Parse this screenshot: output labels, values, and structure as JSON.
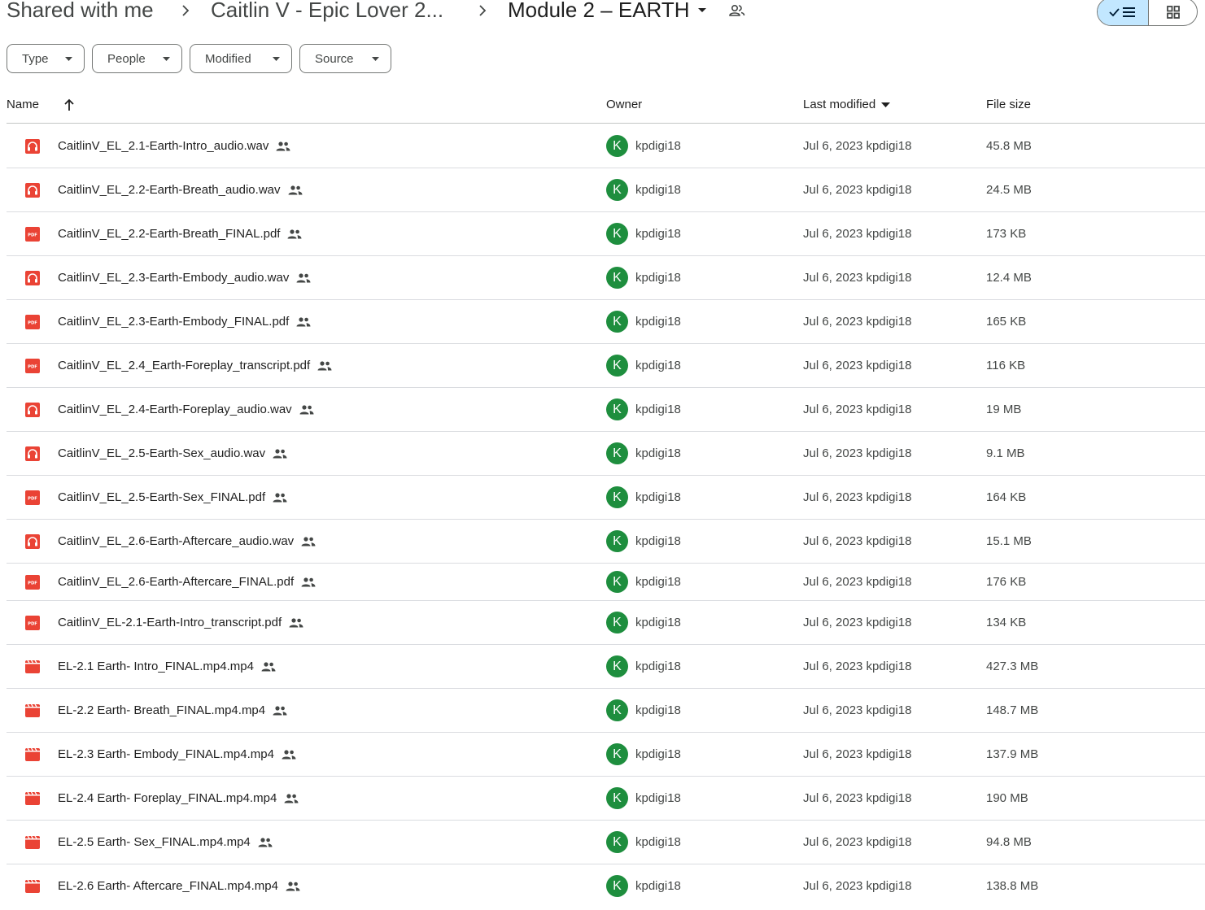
{
  "breadcrumb": {
    "root": "Shared with me",
    "parent": "Caitlin V - Epic Lover 2...",
    "current": "Module 2 – EARTH",
    "separator_icon": "chevron-right-icon",
    "current_menu_icon": "caret-down-icon",
    "shared_icon": "shared-folder-people-icon"
  },
  "view_toggle": {
    "list_icon": "check-list-view-icon",
    "grid_icon": "grid-view-icon",
    "selected": "list"
  },
  "filters": [
    {
      "label": "Type"
    },
    {
      "label": "People"
    },
    {
      "label": "Modified"
    },
    {
      "label": "Source"
    }
  ],
  "columns": {
    "name": "Name",
    "owner": "Owner",
    "last_modified": "Last modified",
    "file_size": "File size",
    "name_sort_icon": "arrow-up-icon",
    "modified_sort_icon": "caret-down-icon"
  },
  "colors": {
    "audio_pdf_red": "#ea4335",
    "owner_avatar_green": "#1e8e3e",
    "list_toggle_selected": "#c2e7ff"
  },
  "files": [
    {
      "name": "CaitlinV_EL_2.1-Earth-Intro_audio.wav",
      "type": "audio",
      "owner_initial": "K",
      "owner": "kpdigi18",
      "modified": "Jul 6, 2023 kpdigi18",
      "size": "45.8 MB"
    },
    {
      "name": "CaitlinV_EL_2.2-Earth-Breath_audio.wav",
      "type": "audio",
      "owner_initial": "K",
      "owner": "kpdigi18",
      "modified": "Jul 6, 2023 kpdigi18",
      "size": "24.5 MB"
    },
    {
      "name": "CaitlinV_EL_2.2-Earth-Breath_FINAL.pdf",
      "type": "pdf",
      "owner_initial": "K",
      "owner": "kpdigi18",
      "modified": "Jul 6, 2023 kpdigi18",
      "size": "173 KB"
    },
    {
      "name": "CaitlinV_EL_2.3-Earth-Embody_audio.wav",
      "type": "audio",
      "owner_initial": "K",
      "owner": "kpdigi18",
      "modified": "Jul 6, 2023 kpdigi18",
      "size": "12.4 MB"
    },
    {
      "name": "CaitlinV_EL_2.3-Earth-Embody_FINAL.pdf",
      "type": "pdf",
      "owner_initial": "K",
      "owner": "kpdigi18",
      "modified": "Jul 6, 2023 kpdigi18",
      "size": "165 KB"
    },
    {
      "name": "CaitlinV_EL_2.4_Earth-Foreplay_transcript.pdf",
      "type": "pdf",
      "owner_initial": "K",
      "owner": "kpdigi18",
      "modified": "Jul 6, 2023 kpdigi18",
      "size": "116 KB"
    },
    {
      "name": "CaitlinV_EL_2.4-Earth-Foreplay_audio.wav",
      "type": "audio",
      "owner_initial": "K",
      "owner": "kpdigi18",
      "modified": "Jul 6, 2023 kpdigi18",
      "size": "19 MB"
    },
    {
      "name": "CaitlinV_EL_2.5-Earth-Sex_audio.wav",
      "type": "audio",
      "owner_initial": "K",
      "owner": "kpdigi18",
      "modified": "Jul 6, 2023 kpdigi18",
      "size": "9.1 MB"
    },
    {
      "name": "CaitlinV_EL_2.5-Earth-Sex_FINAL.pdf",
      "type": "pdf",
      "owner_initial": "K",
      "owner": "kpdigi18",
      "modified": "Jul 6, 2023 kpdigi18",
      "size": "164 KB"
    },
    {
      "name": "CaitlinV_EL_2.6-Earth-Aftercare_audio.wav",
      "type": "audio",
      "owner_initial": "K",
      "owner": "kpdigi18",
      "modified": "Jul 6, 2023 kpdigi18",
      "size": "15.1 MB"
    },
    {
      "name": "CaitlinV_EL_2.6-Earth-Aftercare_FINAL.pdf",
      "type": "pdf",
      "owner_initial": "K",
      "owner": "kpdigi18",
      "modified": "Jul 6, 2023 kpdigi18",
      "size": "176 KB"
    },
    {
      "name": "CaitlinV_EL-2.1-Earth-Intro_transcript.pdf",
      "type": "pdf",
      "owner_initial": "K",
      "owner": "kpdigi18",
      "modified": "Jul 6, 2023 kpdigi18",
      "size": "134 KB"
    },
    {
      "name": "EL-2.1 Earth- Intro_FINAL.mp4.mp4",
      "type": "video",
      "owner_initial": "K",
      "owner": "kpdigi18",
      "modified": "Jul 6, 2023 kpdigi18",
      "size": "427.3 MB"
    },
    {
      "name": "EL-2.2 Earth- Breath_FINAL.mp4.mp4",
      "type": "video",
      "owner_initial": "K",
      "owner": "kpdigi18",
      "modified": "Jul 6, 2023 kpdigi18",
      "size": "148.7 MB"
    },
    {
      "name": "EL-2.3 Earth- Embody_FINAL.mp4.mp4",
      "type": "video",
      "owner_initial": "K",
      "owner": "kpdigi18",
      "modified": "Jul 6, 2023 kpdigi18",
      "size": "137.9 MB"
    },
    {
      "name": "EL-2.4 Earth- Foreplay_FINAL.mp4.mp4",
      "type": "video",
      "owner_initial": "K",
      "owner": "kpdigi18",
      "modified": "Jul 6, 2023 kpdigi18",
      "size": "190 MB"
    },
    {
      "name": "EL-2.5 Earth- Sex_FINAL.mp4.mp4",
      "type": "video",
      "owner_initial": "K",
      "owner": "kpdigi18",
      "modified": "Jul 6, 2023 kpdigi18",
      "size": "94.8 MB"
    },
    {
      "name": "EL-2.6 Earth- Aftercare_FINAL.mp4.mp4",
      "type": "video",
      "owner_initial": "K",
      "owner": "kpdigi18",
      "modified": "Jul 6, 2023 kpdigi18",
      "size": "138.8 MB"
    }
  ]
}
